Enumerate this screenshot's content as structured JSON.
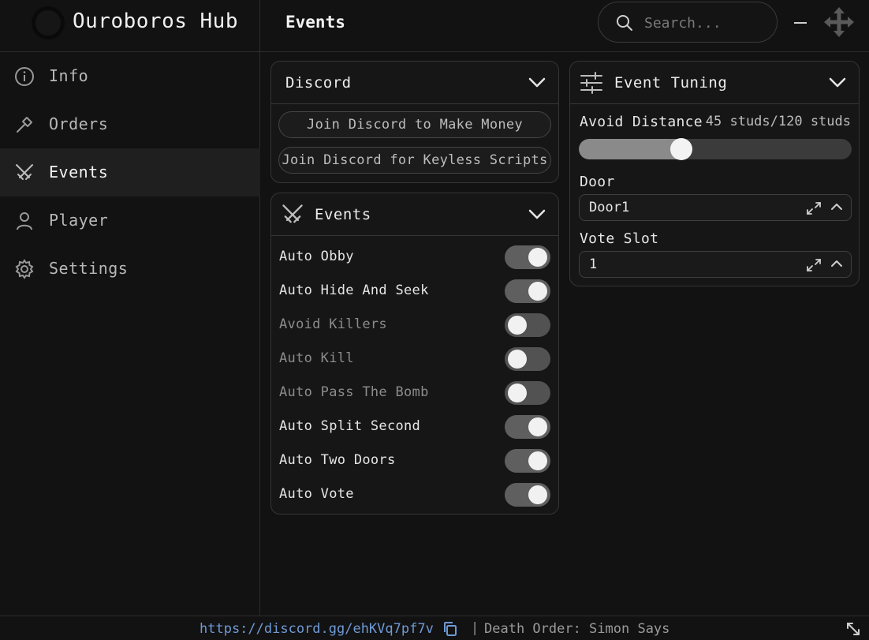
{
  "app": {
    "title": "Ouroboros Hub",
    "page_title": "Events"
  },
  "search": {
    "placeholder": "Search..."
  },
  "sidebar": {
    "items": [
      {
        "label": "Info",
        "icon": "info-icon"
      },
      {
        "label": "Orders",
        "icon": "hammer-icon"
      },
      {
        "label": "Events",
        "icon": "crossed-swords-icon",
        "active": true
      },
      {
        "label": "Player",
        "icon": "user-icon"
      },
      {
        "label": "Settings",
        "icon": "gear-icon"
      }
    ]
  },
  "discord_panel": {
    "title": "Discord",
    "buttons": [
      "Join Discord to Make Money",
      "Join Discord for Keyless Scripts"
    ]
  },
  "events_panel": {
    "title": "Events",
    "toggles": [
      {
        "label": "Auto Obby",
        "on": true
      },
      {
        "label": "Auto Hide And Seek",
        "on": true
      },
      {
        "label": "Avoid Killers",
        "on": false
      },
      {
        "label": "Auto Kill",
        "on": false
      },
      {
        "label": "Auto Pass The Bomb",
        "on": false
      },
      {
        "label": "Auto Split Second",
        "on": true
      },
      {
        "label": "Auto Two Doors",
        "on": true
      },
      {
        "label": "Auto Vote",
        "on": true
      }
    ]
  },
  "tuning_panel": {
    "title": "Event Tuning",
    "avoid_distance": {
      "label": "Avoid Distance",
      "value_text": "45 studs/120 studs",
      "value": 45,
      "max": 120
    },
    "door": {
      "label": "Door",
      "value": "Door1"
    },
    "vote_slot": {
      "label": "Vote Slot",
      "value": "1"
    }
  },
  "footer": {
    "link": "https://discord.gg/ehKVq7pf7v",
    "separator": "|",
    "status": "Death Order: Simon Says"
  },
  "colors": {
    "accent_link": "#6f9ad6",
    "toggle_knob": "#f1f1f1",
    "background": "#121212"
  }
}
